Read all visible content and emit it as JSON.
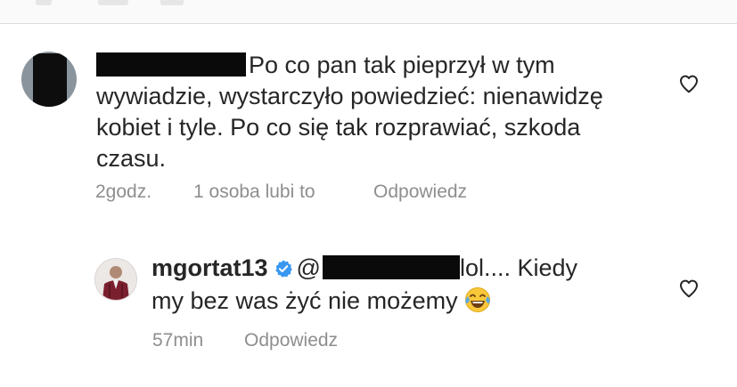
{
  "comments": [
    {
      "text": "Po co pan tak pieprzył w tym wywiadzie, wystarczyło powiedzieć: nienawidzę kobiet i tyle. Po co się tak rozprawiać, szkoda czasu.",
      "time": "2godz.",
      "likes": "1 osoba lubi to",
      "reply_label": "Odpowiedz",
      "like_icon": "heart-outline-icon"
    }
  ],
  "reply": {
    "username": "mgortat13",
    "verified_icon": "verified-badge-icon",
    "mention_prefix": "@",
    "text_after_mention": "lol.... Kiedy",
    "text_line2": "my bez was żyć nie możemy",
    "emoji": "tears-of-joy-emoji",
    "time": "57min",
    "reply_label": "Odpowiedz",
    "like_icon": "heart-outline-icon"
  },
  "colors": {
    "text": "#262626",
    "meta": "#8e8e8e",
    "verified": "#3897f0",
    "redaction": "#0a0a0a"
  }
}
